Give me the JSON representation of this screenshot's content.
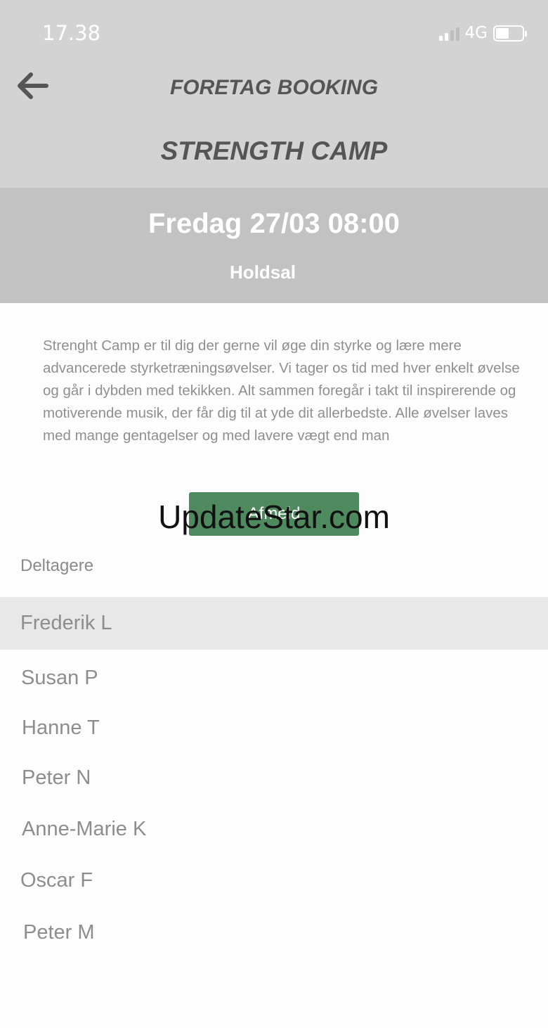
{
  "status_bar": {
    "time": "17.38",
    "network": "4G"
  },
  "header": {
    "title": "FORETAG BOOKING",
    "class_name": "STRENGTH CAMP"
  },
  "session": {
    "datetime": "Fredag 27/03 08:00",
    "room": "Holdsal"
  },
  "description": "Strenght Camp er til dig der gerne vil øge din styrke og lære mere advancerede styrketræningsøvelser. Vi tager os tid med hver enkelt øvelse og går i dybden med tekikken. Alt sammen foregår i takt til inspirerende og motiverende musik, der får dig til at yde dit allerbedste. Alle øvelser laves med mange gentagelser og med lavere vægt end man",
  "actions": {
    "cancel_label": "Afmeld"
  },
  "watermark": "UpdateStar.com",
  "participants_label": "Deltagere",
  "participants": [
    {
      "name": "Frederik L"
    },
    {
      "name": "Susan P"
    },
    {
      "name": "Hanne T"
    },
    {
      "name": "Peter N"
    },
    {
      "name": "Anne-Marie K"
    },
    {
      "name": "Oscar F"
    },
    {
      "name": "Peter M"
    }
  ],
  "colors": {
    "header_bg": "#d3d3d3",
    "date_band_bg": "#c2c2c2",
    "button_bg": "#4f8a5e",
    "selected_row_bg": "#e8e8e8"
  }
}
